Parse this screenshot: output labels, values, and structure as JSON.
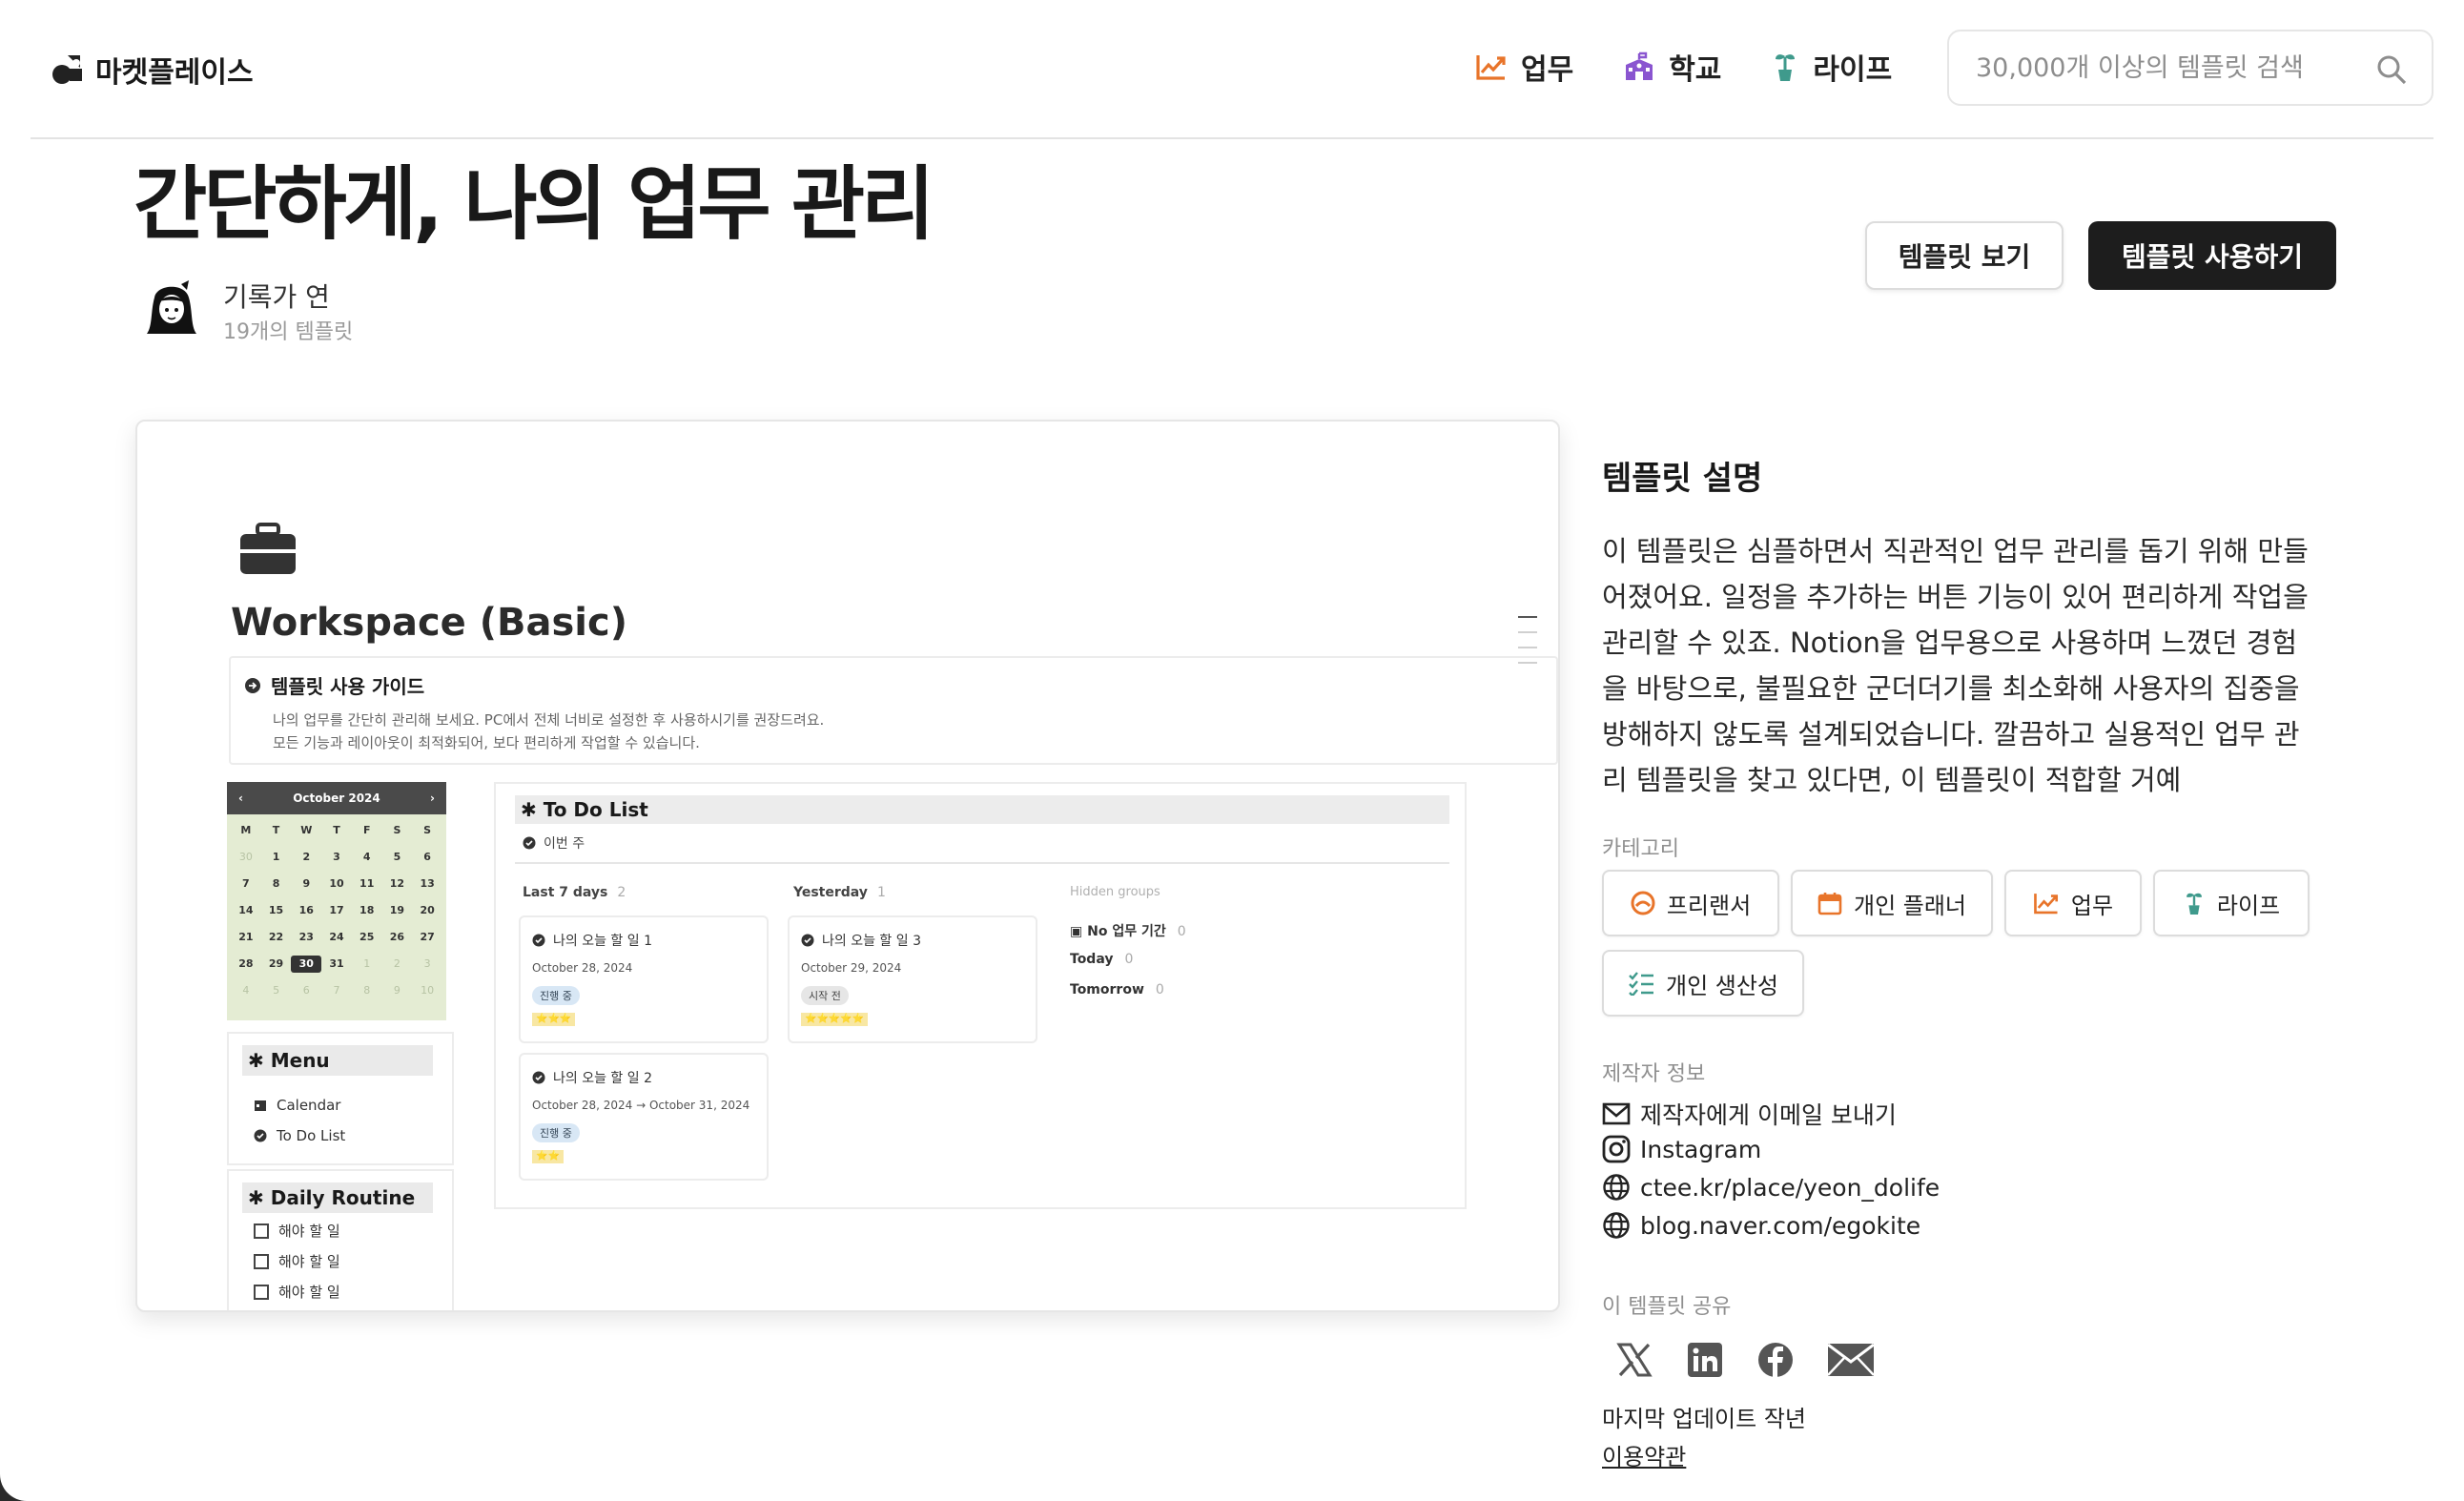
{
  "header": {
    "brand": "마켓플레이스",
    "nav": [
      {
        "label": "업무",
        "icon": "chart-line-icon"
      },
      {
        "label": "학교",
        "icon": "school-icon"
      },
      {
        "label": "라이프",
        "icon": "plant-icon"
      }
    ],
    "search_placeholder": "30,000개 이상의 템플릿 검색"
  },
  "template": {
    "title": "간단하게, 나의 업무 관리",
    "author_name": "기록가 연",
    "author_count": "19개의 템플릿",
    "view_label": "템플릿 보기",
    "use_label": "템플릿 사용하기"
  },
  "preview": {
    "title": "Workspace (Basic)",
    "guide_title": "템플릿 사용 가이드",
    "guide_line1": "나의 업무를 간단히 관리해 보세요. PC에서 전체 너비로 설정한 후 사용하시기를 권장드려요.",
    "guide_line2": "모든 기능과 레이아웃이 최적화되어, 보다 편리하게 작업할 수 있습니다.",
    "calendar": {
      "month": "October 2024",
      "weekdays": [
        "M",
        "T",
        "W",
        "T",
        "F",
        "S",
        "S"
      ],
      "days": [
        "30",
        "1",
        "2",
        "3",
        "4",
        "5",
        "6",
        "7",
        "8",
        "9",
        "10",
        "11",
        "12",
        "13",
        "14",
        "15",
        "16",
        "17",
        "18",
        "19",
        "20",
        "21",
        "22",
        "23",
        "24",
        "25",
        "26",
        "27",
        "28",
        "29",
        "30",
        "31",
        "1",
        "2",
        "3",
        "4",
        "5",
        "6",
        "7",
        "8",
        "9",
        "10"
      ]
    },
    "menu": {
      "title": "✱ Menu",
      "items": [
        "Calendar",
        "To Do List"
      ]
    },
    "routine": {
      "title": "✱ Daily Routine",
      "items": [
        "해야 할 일",
        "해야 할 일",
        "해야 할 일"
      ]
    },
    "todo": {
      "title": "✱ To Do List",
      "week": "이번 주",
      "col1": {
        "label": "Last 7 days",
        "count": "2"
      },
      "col2": {
        "label": "Yesterday",
        "count": "1"
      },
      "cards": [
        {
          "title": "나의 오늘 할 일 1",
          "date": "October 28, 2024",
          "tag": "진행 중",
          "stars": "⭐⭐⭐"
        },
        {
          "title": "나의 오늘 할 일 2",
          "date": "October 28, 2024 → October 31, 2024",
          "tag": "진행 중",
          "stars": "⭐⭐"
        },
        {
          "title": "나의 오늘 할 일 3",
          "date": "October 29, 2024",
          "tag": "시작 전",
          "stars": "⭐⭐⭐⭐⭐"
        }
      ],
      "hidden_label": "Hidden groups",
      "hidden": [
        {
          "label": "No 업무 기간",
          "count": "0"
        },
        {
          "label": "Today",
          "count": "0"
        },
        {
          "label": "Tomorrow",
          "count": "0"
        }
      ]
    }
  },
  "description": {
    "title": "템플릿 설명",
    "lines": [
      "이 템플릿은 심플하면서 직관적인 업무 관리를 돕기 위해 만들",
      "어졌어요. 일정을 추가하는 버튼 기능이 있어 편리하게 작업을",
      "관리할 수 있죠. Notion을 업무용으로 사용하며 느꼈던 경험",
      "을 바탕으로, 불필요한 군더더기를 최소화해 사용자의 집중을",
      "방해하지 않도록 설계되었습니다. 깔끔하고 실용적인 업무 관",
      "리 템플릿을 찾고 있다면, 이 템플릿이 적합할 거예"
    ]
  },
  "categories": {
    "label": "카테고리",
    "items": [
      {
        "label": "프리랜서",
        "icon": "freelancer-icon"
      },
      {
        "label": "개인 플래너",
        "icon": "calendar-icon"
      },
      {
        "label": "업무",
        "icon": "chart-line-icon"
      },
      {
        "label": "라이프",
        "icon": "plant-icon"
      },
      {
        "label": "개인 생산성",
        "icon": "checklist-icon"
      }
    ]
  },
  "creator": {
    "label": "제작자 정보",
    "email": "제작자에게 이메일 보내기",
    "instagram": "Instagram",
    "site1": "ctee.kr/place/yeon_dolife",
    "site2": "blog.naver.com/egokite"
  },
  "share": {
    "label": "이 템플릿 공유"
  },
  "footer": {
    "updated": "마지막 업데이트 작년",
    "terms": "이용약관"
  },
  "colors": {
    "work": "#e8742a",
    "school": "#8a55d0",
    "life": "#3f9a8c",
    "dark": "#1d1d1d"
  }
}
